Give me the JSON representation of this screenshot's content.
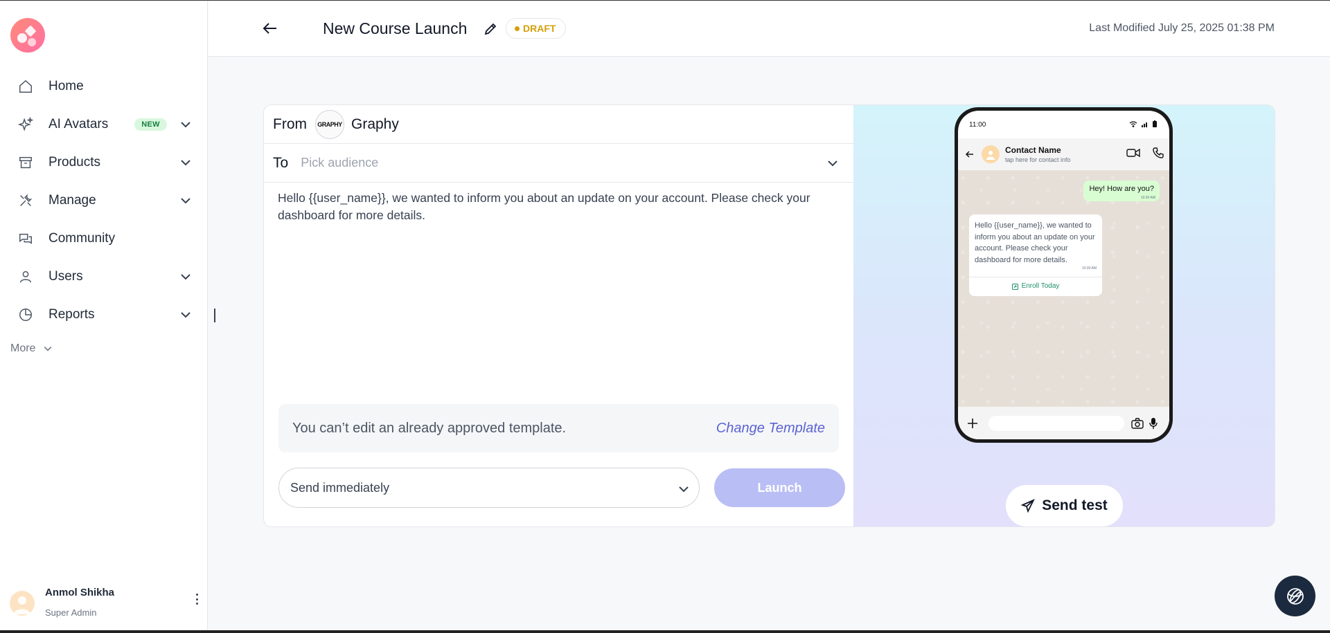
{
  "sidebar": {
    "items": [
      {
        "label": "Home",
        "icon": "home-icon"
      },
      {
        "label": "AI Avatars",
        "icon": "sparkle-icon",
        "badge": "NEW"
      },
      {
        "label": "Products",
        "icon": "archive-box-icon"
      },
      {
        "label": "Manage",
        "icon": "tools-icon"
      },
      {
        "label": "Community",
        "icon": "chat-bubbles-icon"
      },
      {
        "label": "Users",
        "icon": "user-icon"
      },
      {
        "label": "Reports",
        "icon": "pie-chart-icon"
      }
    ],
    "more_label": "More"
  },
  "user": {
    "name": "Anmol Shikha",
    "role": "Super Admin"
  },
  "header": {
    "title": "New Course Launch",
    "status": "DRAFT",
    "last_modified": "Last Modified July 25, 2025 01:38 PM"
  },
  "form": {
    "from_label": "From",
    "from_logo_text": "GRAPHY",
    "from_name": "Graphy",
    "to_label": "To",
    "to_placeholder": "Pick audience",
    "message": "Hello {{user_name}}, we wanted to inform you about an update on your account. Please check your dashboard for more details.",
    "notice": "You can’t edit an already approved template.",
    "change_template": "Change Template",
    "schedule": "Send immediately",
    "launch": "Launch"
  },
  "preview": {
    "time": "11:00",
    "contact_name": "Contact Name",
    "contact_sub": "tap here for contact info",
    "outgoing": "Hey! How are you?",
    "outgoing_time": "10:30 AM",
    "incoming": "Hello {{user_name}}, we wanted to inform you about an update on your account. Please check your dashboard for more details.",
    "incoming_time": "10:30 AM",
    "cta": "Enroll Today",
    "send_test": "Send test"
  },
  "colors": {
    "accent": "#5b63d3",
    "launch_disabled": "#b9bef5",
    "draft": "#d4a007",
    "new_badge": "#d9f7de"
  }
}
